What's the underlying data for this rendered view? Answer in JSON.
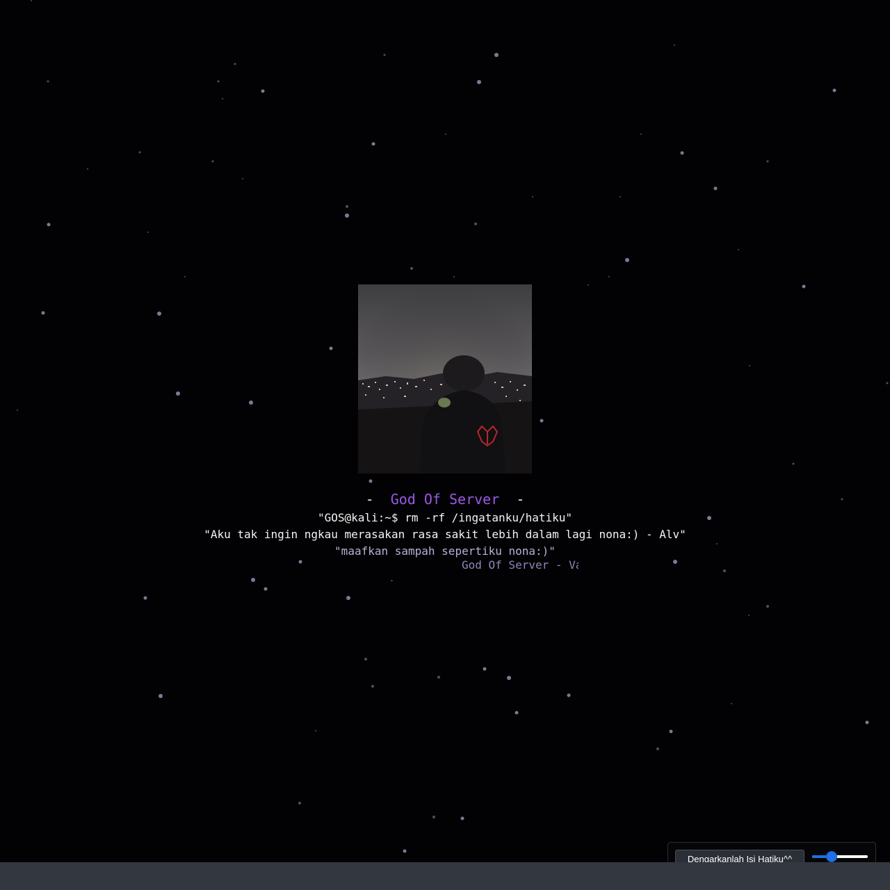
{
  "header": {
    "dash_left": "-",
    "site_name": "God Of Server",
    "dash_right": "-"
  },
  "content": {
    "command": "\"GOS@kali:~$ rm -rf /ingatanku/hatiku\"",
    "quote": "\"Aku tak ingin ngkau merasakan rasa sakit lebih dalam lagi nona:) - Alv\"",
    "apology": "\"maafkan sampah sepertiku nona:)\"",
    "marquee": "God Of Server - Va",
    "small_dash": "-"
  },
  "player": {
    "button_label": "Dengarkanlah Isi Hatiku^^",
    "volume": 0.3
  },
  "colors": {
    "background": "#020204",
    "accent": "#9b59e6",
    "slider": "#1f6fe8",
    "bottom_bar": "#33373f"
  }
}
